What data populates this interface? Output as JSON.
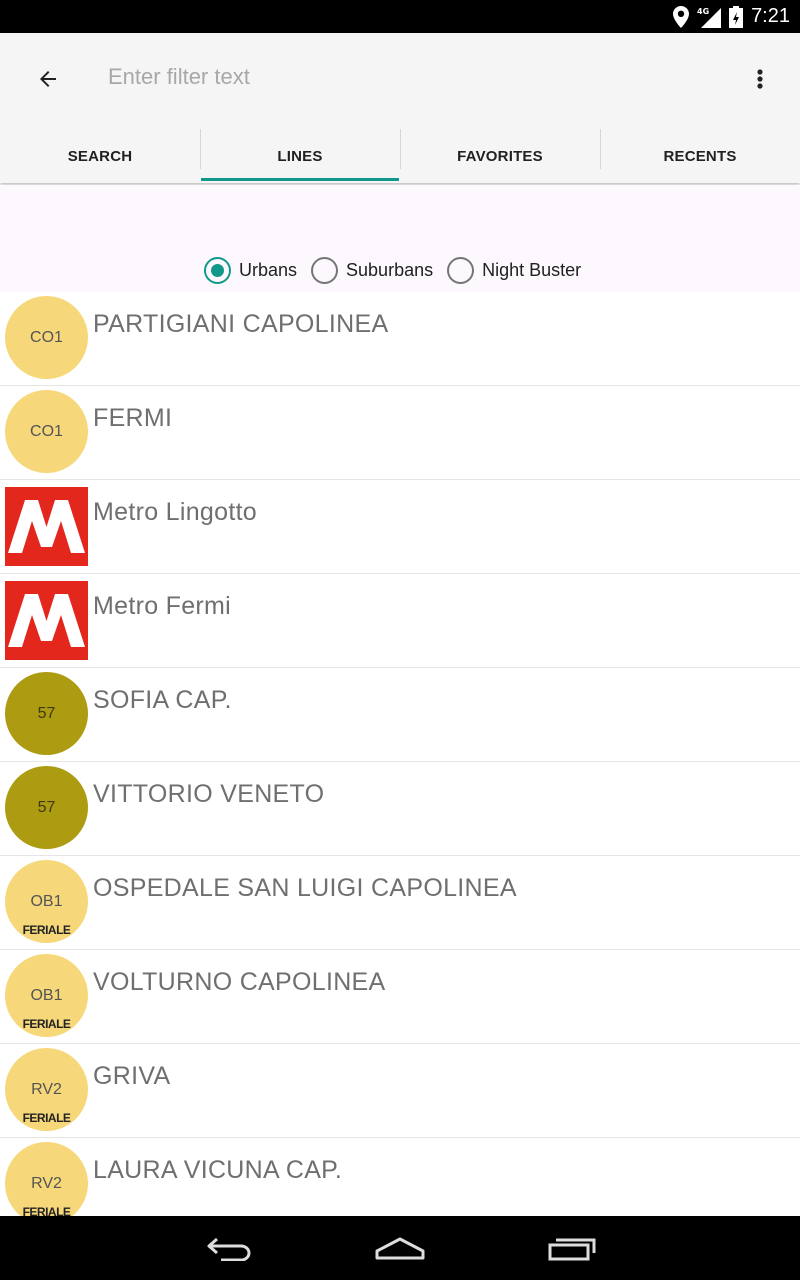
{
  "status_bar": {
    "time": "7:21",
    "network": "4G",
    "icons": [
      "location-icon",
      "signal-icon",
      "battery-icon"
    ]
  },
  "toolbar": {
    "filter_placeholder": "Enter filter text",
    "back_icon": "arrow-back-icon",
    "overflow_icon": "more-vert-icon"
  },
  "tabs": [
    {
      "label": "SEARCH",
      "active": false
    },
    {
      "label": "LINES",
      "active": true
    },
    {
      "label": "FAVORITES",
      "active": false
    },
    {
      "label": "RECENTS",
      "active": false
    }
  ],
  "filters": {
    "options": [
      {
        "label": "Urbans",
        "checked": true
      },
      {
        "label": "Suburbans",
        "checked": false
      },
      {
        "label": "Night Buster",
        "checked": false
      }
    ]
  },
  "lines": [
    {
      "code": "CO1",
      "name": "PARTIGIANI CAPOLINEA",
      "kind": "circle",
      "color": "#f6d87a",
      "sub": ""
    },
    {
      "code": "CO1",
      "name": "FERMI",
      "kind": "circle",
      "color": "#f6d87a",
      "sub": ""
    },
    {
      "code": "M",
      "name": "Metro Lingotto",
      "kind": "metro",
      "color": "#e3271d",
      "sub": ""
    },
    {
      "code": "M",
      "name": "Metro Fermi",
      "kind": "metro",
      "color": "#e3271d",
      "sub": ""
    },
    {
      "code": "57",
      "name": "SOFIA CAP.",
      "kind": "circle",
      "color": "#ad9b12",
      "sub": ""
    },
    {
      "code": "57",
      "name": "VITTORIO VENETO",
      "kind": "circle",
      "color": "#ad9b12",
      "sub": ""
    },
    {
      "code": "OB1",
      "name": "OSPEDALE SAN LUIGI CAPOLINEA",
      "kind": "circle",
      "color": "#f6d87a",
      "sub": "FERIALE"
    },
    {
      "code": "OB1",
      "name": "VOLTURNO CAPOLINEA",
      "kind": "circle",
      "color": "#f6d87a",
      "sub": "FERIALE"
    },
    {
      "code": "RV2",
      "name": "GRIVA",
      "kind": "circle",
      "color": "#f6d87a",
      "sub": "FERIALE"
    },
    {
      "code": "RV2",
      "name": "LAURA VICUNA CAP.",
      "kind": "circle",
      "color": "#f6d87a",
      "sub": "FERIALE"
    }
  ],
  "nav_bar": {
    "icons": [
      "back-nav-icon",
      "home-nav-icon",
      "recents-nav-icon"
    ]
  },
  "colors": {
    "accent": "#11988a",
    "metro_red": "#e3271d"
  }
}
